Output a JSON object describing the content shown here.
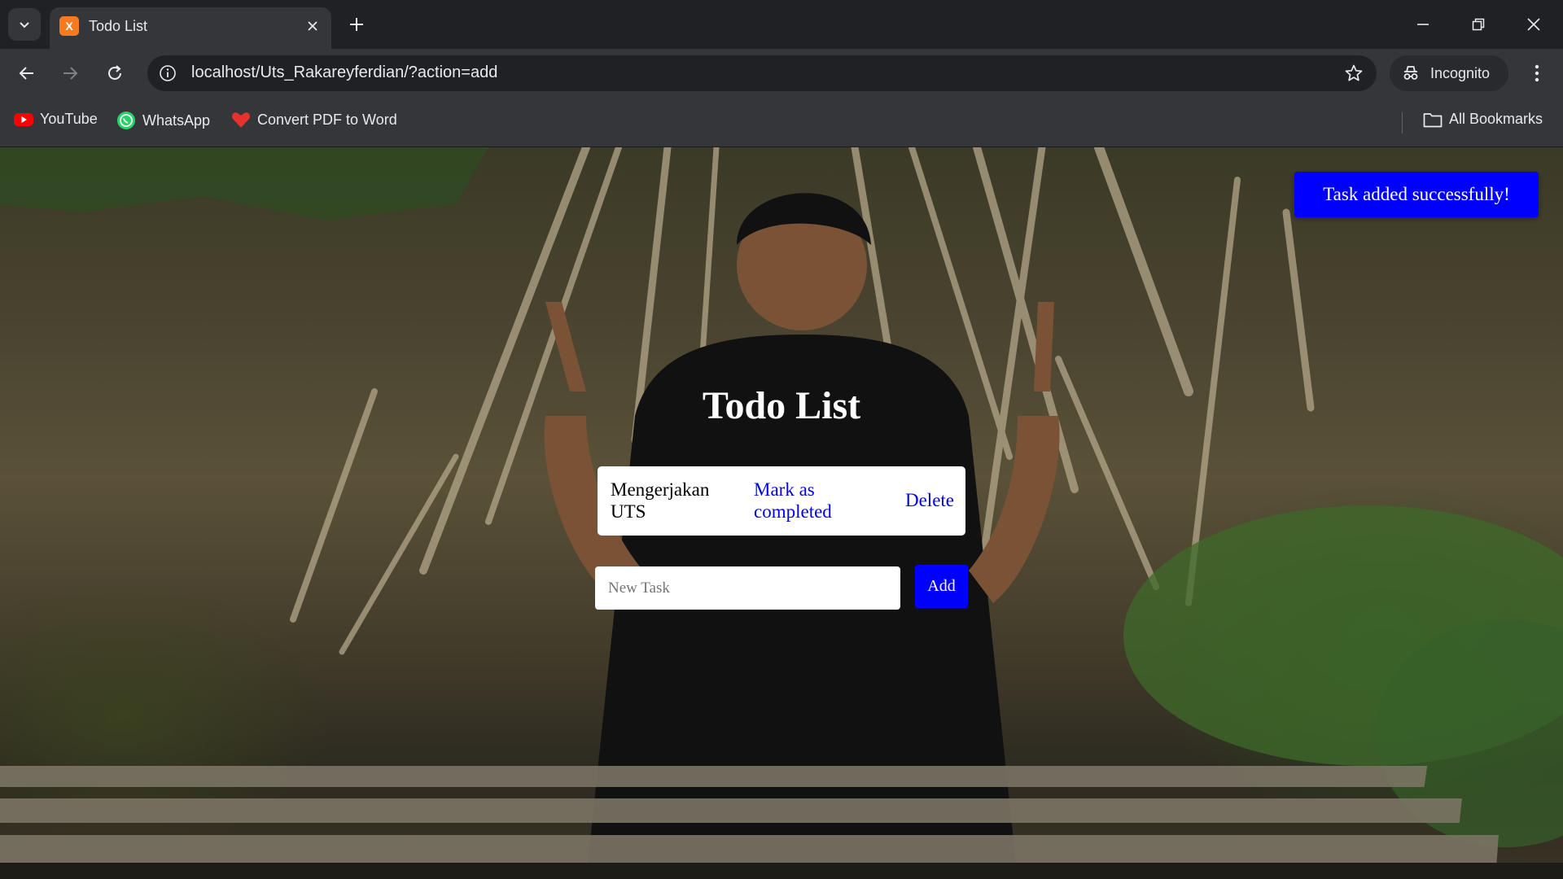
{
  "browser": {
    "tab_title": "Todo List",
    "tab_favicon_text": "X",
    "url": "localhost/Uts_Rakareyferdian/?action=add",
    "incognito_label": "Incognito",
    "bookmarks": [
      {
        "label": "YouTube",
        "icon": "youtube-icon"
      },
      {
        "label": "WhatsApp",
        "icon": "whatsapp-icon"
      },
      {
        "label": "Convert PDF to Word",
        "icon": "pdf-converter-icon"
      }
    ],
    "all_bookmarks_label": "All Bookmarks"
  },
  "page": {
    "toast": "Task added successfully!",
    "title": "Todo List",
    "todos": [
      {
        "text": "Mengerjakan UTS",
        "mark_label": "Mark as completed",
        "delete_label": "Delete"
      }
    ],
    "new_task_placeholder": "New Task",
    "new_task_value": "",
    "add_label": "Add"
  },
  "colors": {
    "accent": "#0000ff",
    "link": "#0000ee",
    "chrome_dark": "#202124",
    "chrome_mid": "#35363a"
  }
}
